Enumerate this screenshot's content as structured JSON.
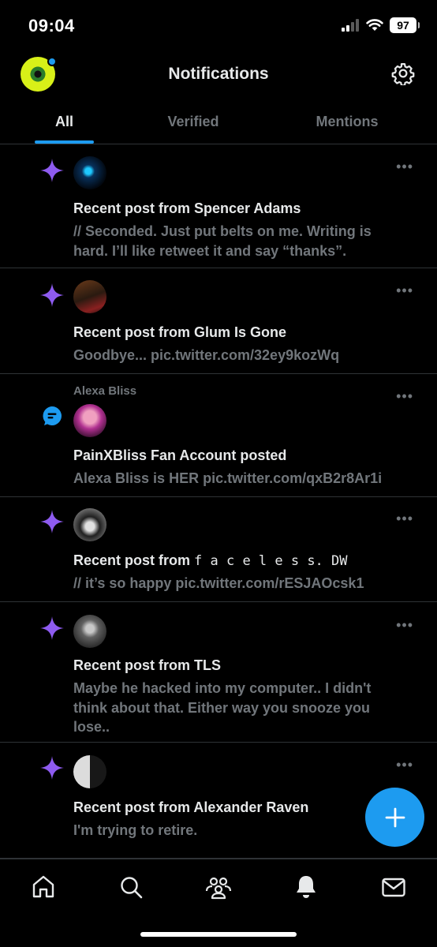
{
  "status_bar": {
    "time": "09:04",
    "battery": "97",
    "icons": [
      "signal-icon",
      "wifi-icon",
      "battery-icon"
    ]
  },
  "header": {
    "title": "Notifications",
    "icons": [
      "avatar",
      "gear-icon"
    ]
  },
  "tabs": [
    {
      "label": "All",
      "active": true
    },
    {
      "label": "Verified",
      "active": false
    },
    {
      "label": "Mentions",
      "active": false
    }
  ],
  "notifications": [
    {
      "icon": "sparkle-icon",
      "title": "Recent post from Spencer Adams",
      "body": "// Seconded. Just put belts on me. Writing is hard. I’ll like retweet it and say “thanks”."
    },
    {
      "icon": "sparkle-icon",
      "title": "Recent post from Glum Is Gone",
      "body": "Goodbye... pic.twitter.com/32ey9kozWq"
    },
    {
      "icon": "message-bubble-icon",
      "label": "Alexa Bliss",
      "title": "PainXBliss Fan Account posted",
      "body": "Alexa Bliss is HER pic.twitter.com/qxB2r8Ar1i"
    },
    {
      "icon": "sparkle-icon",
      "title_prefix": "Recent post from ",
      "title_name": "f a c e l e s s. DW",
      "body": "// it’s so happy pic.twitter.com/rESJAOcsk1"
    },
    {
      "icon": "sparkle-icon",
      "title": "Recent post from TLS",
      "body": "Maybe he hacked into my computer.. I didn't think about that. Either way you snooze you lose.."
    },
    {
      "icon": "sparkle-icon",
      "title": "Recent post from Alexander Raven",
      "body": "I'm trying to retire."
    }
  ],
  "more_label": "•••",
  "compose_button": {
    "icon": "plus-icon"
  },
  "bottom_nav": [
    "home-icon",
    "search-icon",
    "communities-icon",
    "bell-icon",
    "mail-icon"
  ],
  "colors": {
    "accent": "#1d9bf0",
    "sparkle": "#8e5bf0",
    "background": "#000000",
    "muted": "#71767b",
    "divider": "#2f3336"
  }
}
